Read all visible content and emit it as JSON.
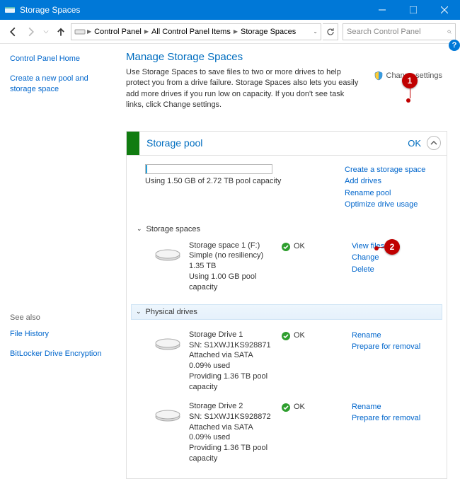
{
  "window": {
    "title": "Storage Spaces"
  },
  "nav": {
    "crumbs": [
      "Control Panel",
      "All Control Panel Items",
      "Storage Spaces"
    ],
    "search_placeholder": "Search Control Panel"
  },
  "sidebar": {
    "home": "Control Panel Home",
    "create_pool": "Create a new pool and storage space",
    "see_also_label": "See also",
    "see_also": [
      "File History",
      "BitLocker Drive Encryption"
    ]
  },
  "page": {
    "heading": "Manage Storage Spaces",
    "description": "Use Storage Spaces to save files to two or more drives to help protect you from a drive failure. Storage Spaces also lets you easily add more drives if you run low on capacity. If you don't see task links, click Change settings.",
    "change_settings": "Change settings",
    "help_tooltip": "?"
  },
  "pool": {
    "title": "Storage pool",
    "status": "OK",
    "usage_text": "Using 1.50 GB of 2.72 TB pool capacity",
    "links": [
      "Create a storage space",
      "Add drives",
      "Rename pool",
      "Optimize drive usage"
    ]
  },
  "spaces": {
    "label": "Storage spaces",
    "items": [
      {
        "name": "Storage space 1 (F:)",
        "resiliency": "Simple (no resiliency)",
        "size": "1.35 TB",
        "usage": "Using 1.00 GB pool capacity",
        "status": "OK",
        "links": [
          "View files",
          "Change",
          "Delete"
        ]
      }
    ]
  },
  "physical": {
    "label": "Physical drives",
    "items": [
      {
        "name": "Storage Drive 1",
        "serial": "SN: S1XWJ1KS928871",
        "attach": "Attached via SATA",
        "used": "0.09% used",
        "provide": "Providing 1.36 TB pool capacity",
        "status": "OK",
        "links": [
          "Rename",
          "Prepare for removal"
        ]
      },
      {
        "name": "Storage Drive 2",
        "serial": "SN: S1XWJ1KS928872",
        "attach": "Attached via SATA",
        "used": "0.09% used",
        "provide": "Providing 1.36 TB pool capacity",
        "status": "OK",
        "links": [
          "Rename",
          "Prepare for removal"
        ]
      }
    ]
  },
  "annotations": {
    "1": "1",
    "2": "2"
  }
}
